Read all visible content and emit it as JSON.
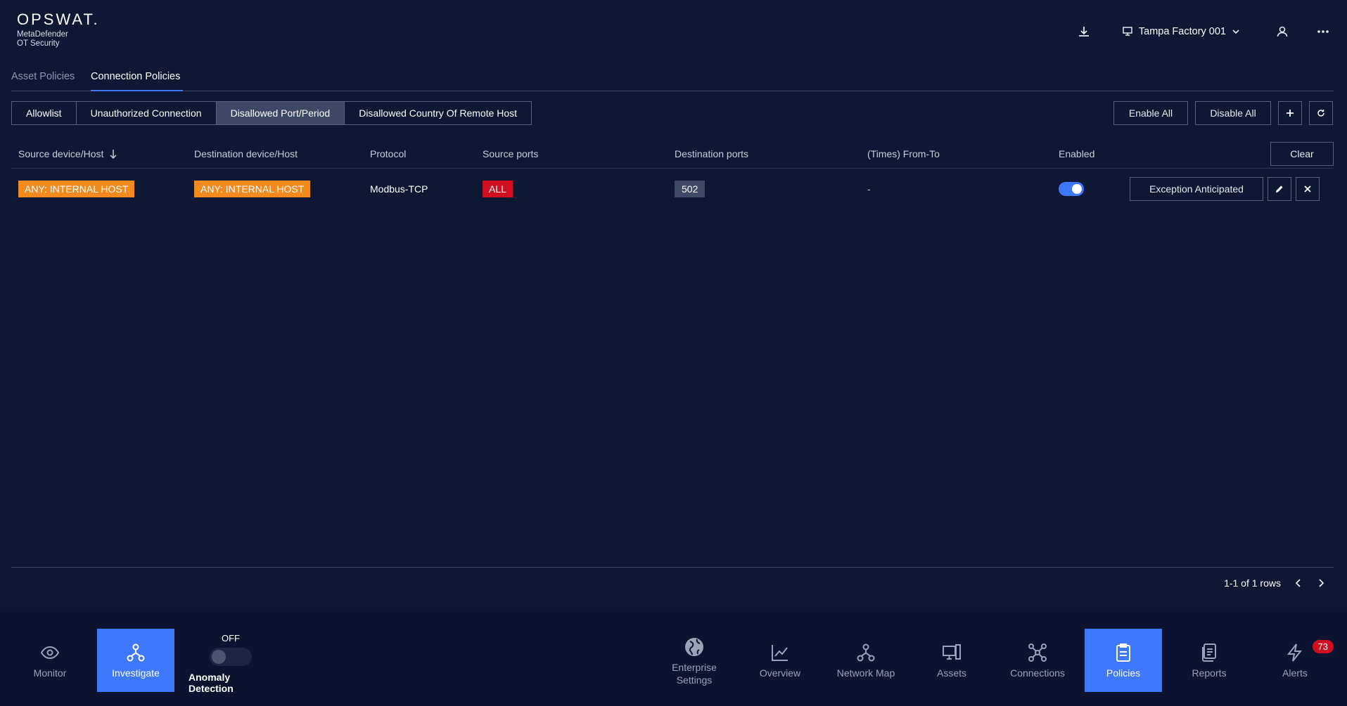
{
  "header": {
    "logo": "OPSWAT.",
    "product_line1": "MetaDefender",
    "product_line2": "OT Security",
    "site_name": "Tampa Factory 001"
  },
  "tabs": [
    {
      "label": "Asset Policies",
      "active": false
    },
    {
      "label": "Connection Policies",
      "active": true
    }
  ],
  "filters": [
    {
      "label": "Allowlist",
      "selected": false
    },
    {
      "label": "Unauthorized Connection",
      "selected": false
    },
    {
      "label": "Disallowed Port/Period",
      "selected": true
    },
    {
      "label": "Disallowed Country Of Remote Host",
      "selected": false
    }
  ],
  "actions": {
    "enable_all": "Enable All",
    "disable_all": "Disable All",
    "clear": "Clear"
  },
  "table": {
    "columns": [
      "Source device/Host",
      "Destination device/Host",
      "Protocol",
      "Source ports",
      "Destination ports",
      "(Times) From-To",
      "Enabled"
    ],
    "rows": [
      {
        "source": "ANY: INTERNAL HOST",
        "destination": "ANY: INTERNAL HOST",
        "protocol": "Modbus-TCP",
        "source_ports": "ALL",
        "destination_ports": "502",
        "times": "-",
        "enabled": true,
        "exception_label": "Exception Anticipated"
      }
    ]
  },
  "pagination": {
    "summary": "1-1 of 1 rows"
  },
  "bottom_nav": {
    "monitor": "Monitor",
    "investigate": "Investigate",
    "anomaly_state": "OFF",
    "anomaly_label": "Anomaly Detection",
    "enterprise_line1": "Enterprise",
    "enterprise_line2": "Settings",
    "overview": "Overview",
    "network_map": "Network Map",
    "assets": "Assets",
    "connections": "Connections",
    "policies": "Policies",
    "reports": "Reports",
    "alerts": "Alerts",
    "alerts_count": "73"
  },
  "colors": {
    "background": "#0e1733",
    "accent": "#3d78ff",
    "host_tag": "#f28a1e",
    "danger": "#d0101e"
  }
}
